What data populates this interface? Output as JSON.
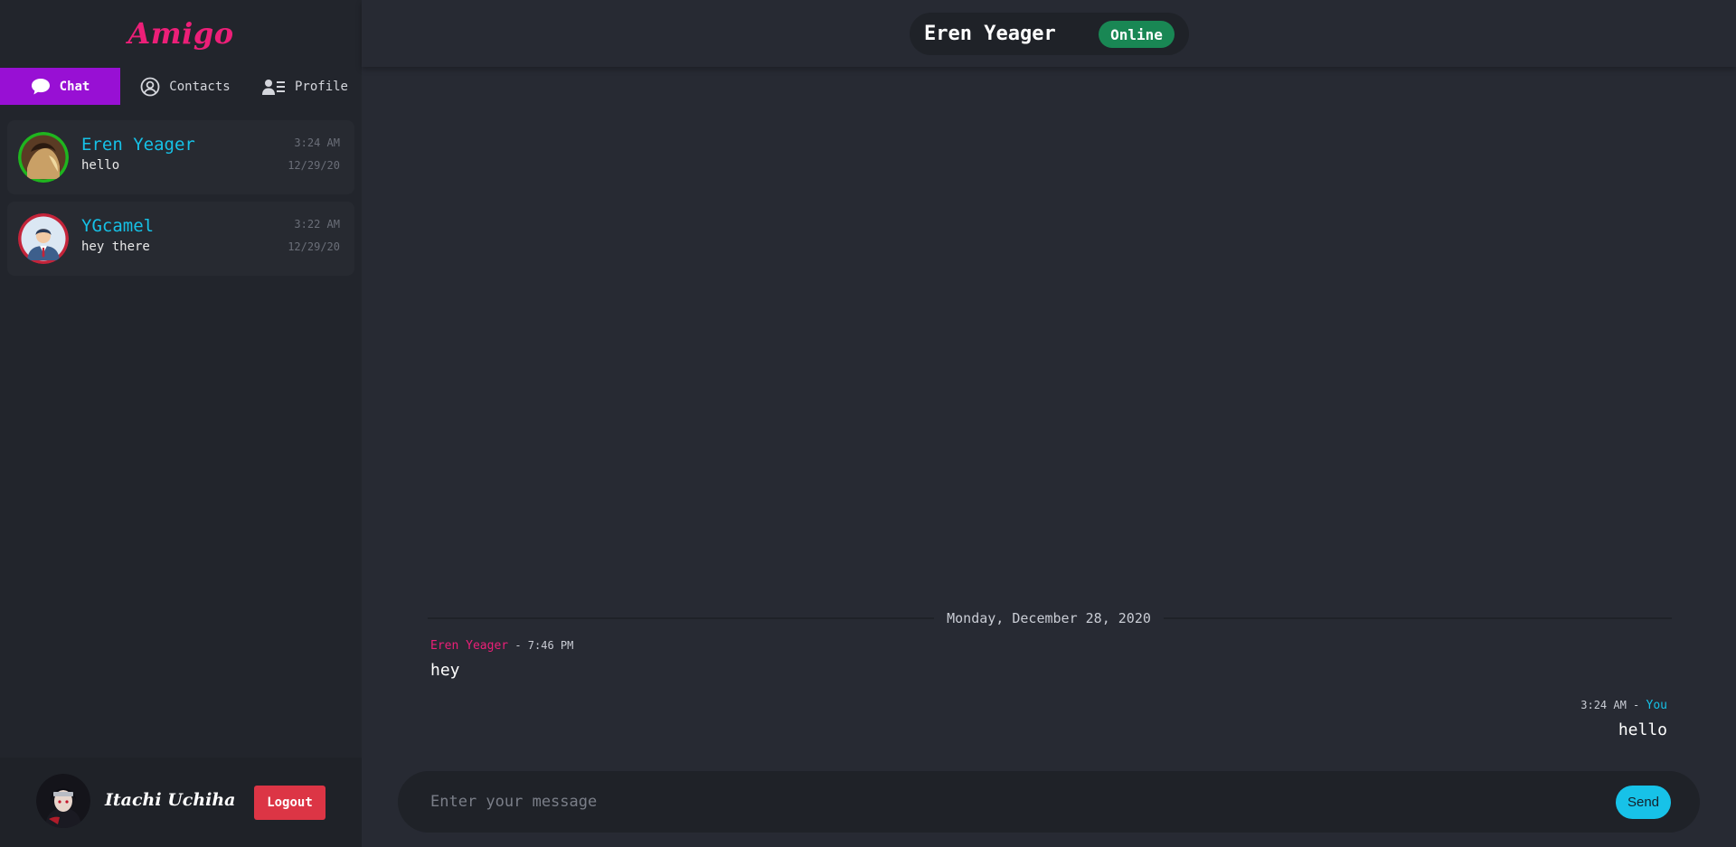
{
  "brand": "Amigo",
  "tabs": [
    {
      "label": "Chat",
      "icon": "chat-bubble-icon"
    },
    {
      "label": "Contacts",
      "icon": "user-circle-icon"
    },
    {
      "label": "Profile",
      "icon": "user-list-icon"
    }
  ],
  "conversations": [
    {
      "name": "Eren Yeager",
      "preview": "hello",
      "time": "3:24 AM",
      "date": "12/29/20",
      "ring_color": "#1fb51f"
    },
    {
      "name": "YGcamel",
      "preview": "hey there",
      "time": "3:22 AM",
      "date": "12/29/20",
      "ring_color": "#c4243a"
    }
  ],
  "user": {
    "name": "Itachi Uchiha",
    "logout_label": "Logout"
  },
  "header": {
    "contact_name": "Eren Yeager",
    "status": "Online"
  },
  "chat": {
    "date_divider": "Monday, December 28, 2020",
    "messages": [
      {
        "sender": "Eren Yeager",
        "separator": " - ",
        "time": "7:46 PM",
        "text": "hey"
      },
      {
        "sender": "You",
        "separator": " - ",
        "time": "3:24 AM",
        "text": "hello"
      }
    ]
  },
  "composer": {
    "placeholder": "Enter your message",
    "send_label": "Send"
  },
  "colors": {
    "brand": "#ec1f78",
    "active_tab": "#9810d4",
    "contact_name": "#16c1e6",
    "online": "#198754",
    "logout": "#dc3545",
    "send": "#17c2e8"
  }
}
